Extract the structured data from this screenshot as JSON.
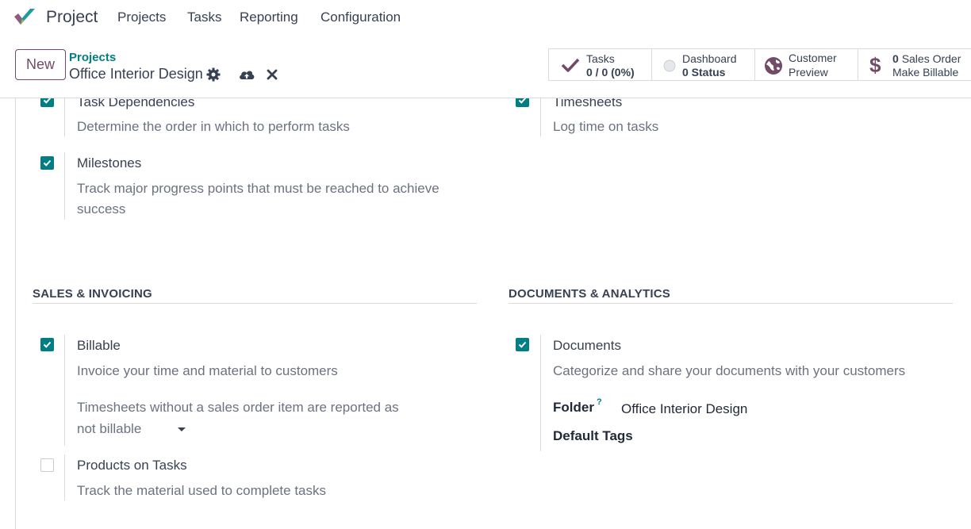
{
  "app": {
    "name": "Project"
  },
  "nav": {
    "menu": [
      "Projects",
      "Tasks",
      "Reporting",
      "Configuration"
    ]
  },
  "control": {
    "new_label": "New",
    "breadcrumb": "Projects",
    "record_title": "Office Interior Design",
    "icons": [
      "gear-icon",
      "cloud-upload-icon",
      "discard-icon"
    ]
  },
  "smart_buttons": {
    "tasks": {
      "label": "Tasks",
      "value": "0 / 0 (0%)"
    },
    "dashboard": {
      "label": "Dashboard",
      "value": "0 Status"
    },
    "customer": {
      "line1": "Customer",
      "line2": "Preview"
    },
    "sales": {
      "count": "0",
      "line1": "Sales Order",
      "line2": "Make Billable"
    }
  },
  "settings_top": {
    "task_dependencies": {
      "label": "Task Dependencies",
      "desc": "Determine the order in which to perform tasks",
      "checked": true
    },
    "milestones": {
      "label": "Milestones",
      "desc": "Track major progress points that must be reached to achieve success",
      "checked": true
    },
    "timesheets": {
      "label": "Timesheets",
      "desc": "Log time on tasks",
      "checked": true
    }
  },
  "sales_invoicing": {
    "title": "SALES & INVOICING",
    "billable": {
      "label": "Billable",
      "desc": "Invoice your time and material to customers",
      "checked": true,
      "note": "Timesheets without a sales order item are reported as",
      "select_value": "not billable"
    },
    "products_on_tasks": {
      "label": "Products on Tasks",
      "desc": "Track the material used to complete tasks",
      "checked": false
    }
  },
  "documents_analytics": {
    "title": "DOCUMENTS & ANALYTICS",
    "documents": {
      "label": "Documents",
      "desc": "Categorize and share your documents with your customers",
      "checked": true,
      "folder_label": "Folder",
      "folder_help": "?",
      "folder_value": "Office Interior Design",
      "tags_label": "Default Tags"
    }
  },
  "colors": {
    "accent": "#017e84",
    "brand": "#714b67",
    "text": "#374151",
    "muted": "#6b7280",
    "border": "#d8dadd"
  }
}
